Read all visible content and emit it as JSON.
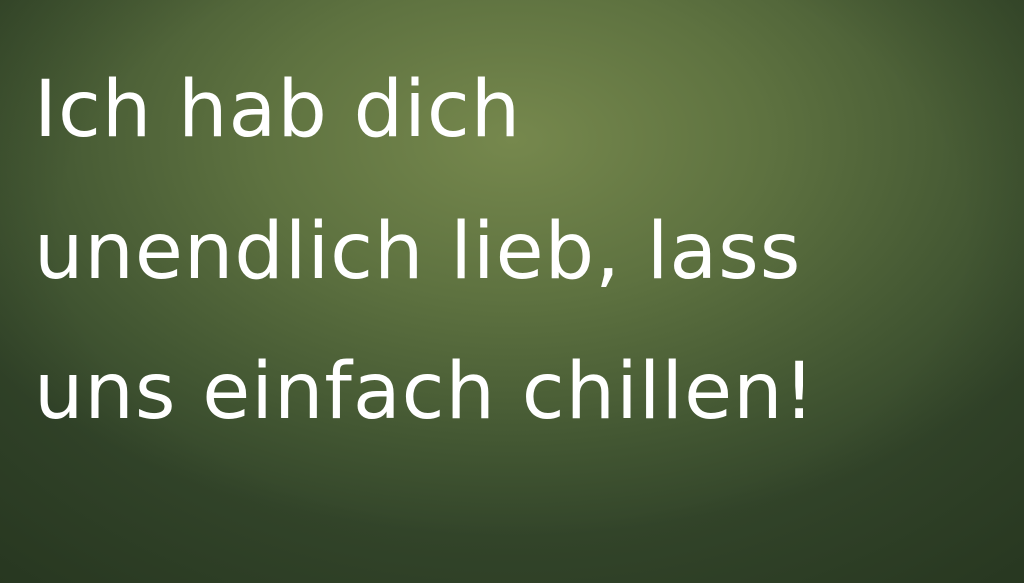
{
  "quote": {
    "lines": [
      "Ich hab dich",
      "unendlich lieb, lass",
      "uns einfach chillen!"
    ]
  },
  "colors": {
    "background_center": "#76884d",
    "background_edge": "#33452a",
    "text": "#ffffff"
  }
}
